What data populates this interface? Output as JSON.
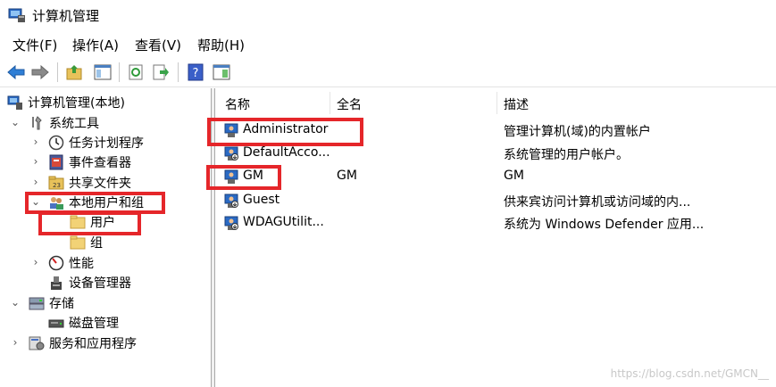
{
  "window": {
    "title": "计算机管理"
  },
  "menu": [
    "文件(F)",
    "操作(A)",
    "查看(V)",
    "帮助(H)"
  ],
  "tree": {
    "root": "计算机管理(本地)",
    "system_tools": "系统工具",
    "task_scheduler": "任务计划程序",
    "event_viewer": "事件查看器",
    "shared_folders": "共享文件夹",
    "local_users_groups": "本地用户和组",
    "users": "用户",
    "groups": "组",
    "performance": "性能",
    "device_manager": "设备管理器",
    "storage": "存储",
    "disk_management": "磁盘管理",
    "services_apps": "服务和应用程序"
  },
  "list": {
    "columns": [
      "名称",
      "全名",
      "描述"
    ],
    "rows": [
      {
        "name": "Administrator",
        "fullname": "",
        "desc": "管理计算机(域)的内置帐户"
      },
      {
        "name": "DefaultAcco...",
        "fullname": "",
        "desc": "系统管理的用户帐户。"
      },
      {
        "name": "GM",
        "fullname": "GM",
        "desc": "GM"
      },
      {
        "name": "Guest",
        "fullname": "",
        "desc": "供来宾访问计算机或访问域的内..."
      },
      {
        "name": "WDAGUtilit...",
        "fullname": "",
        "desc": "系统为 Windows Defender 应用..."
      }
    ]
  },
  "watermark": "https://blog.csdn.net/GMCN__",
  "colors": {
    "annotation": "#e5262a",
    "accent": "#0a64c8"
  }
}
